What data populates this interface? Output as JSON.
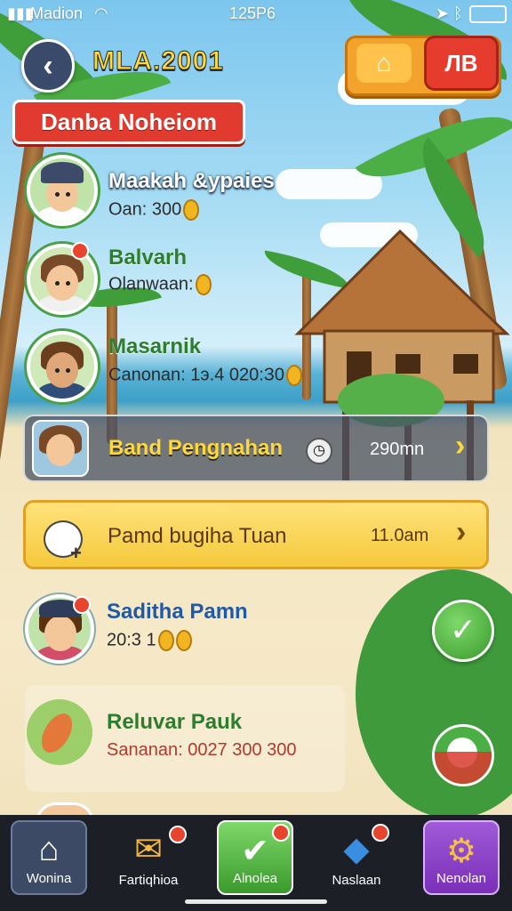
{
  "status_bar": {
    "carrier": "Madion",
    "time": "125P6"
  },
  "header": {
    "title": "MLA.2001",
    "right_button": "ЛB"
  },
  "banner": {
    "label": "Danba Noheiom"
  },
  "friends": [
    {
      "name": "Maakah &ypaies",
      "detail": "Oan: 300"
    },
    {
      "name": "Balvarh",
      "detail": "Olanwaan:"
    },
    {
      "name": "Masarnik",
      "detail": "Canonan: 1э.4 020:З0"
    }
  ],
  "highlight_rows": [
    {
      "name": "Band Pengnahan",
      "value": "290mn"
    },
    {
      "name": "Pamd bugiha Tuan",
      "value": "11.0am"
    }
  ],
  "lower_rows": [
    {
      "name": "Saditha Pamn",
      "detail": "20:3 1"
    },
    {
      "name": "Reluvar Pauk",
      "detail": "Sananan: 0027 300 300"
    }
  ],
  "bottom_nav": [
    {
      "label": "Wonina",
      "icon": "home-icon"
    },
    {
      "label": "Fartiqhioa",
      "icon": "envelope-icon"
    },
    {
      "label": "Alnolea",
      "icon": "chat-icon"
    },
    {
      "label": "Naslaan",
      "icon": "tag-icon"
    },
    {
      "label": "Nenolan",
      "icon": "gear-icon"
    }
  ]
}
